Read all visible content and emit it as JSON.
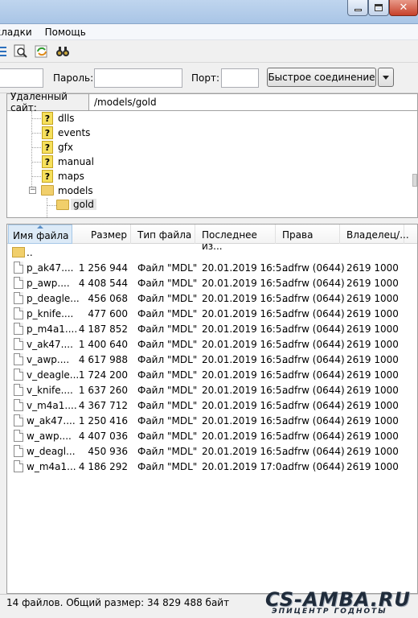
{
  "menubar": {
    "bookmarks": "кладки",
    "help": "Помощь"
  },
  "toolbar": {
    "icons": [
      "filter-icon",
      "search-files-icon",
      "sync-icon",
      "compare-icon"
    ]
  },
  "quickconnect": {
    "password_label": "Пароль:",
    "port_label": "Порт:",
    "button_label": "Быстрое соединение"
  },
  "remote_site": {
    "label": "Удаленный сайт:",
    "path": "/models/gold"
  },
  "tree": {
    "items": [
      {
        "label": "dlls"
      },
      {
        "label": "events"
      },
      {
        "label": "gfx"
      },
      {
        "label": "manual"
      },
      {
        "label": "maps"
      },
      {
        "label": "models"
      },
      {
        "label": "gold"
      }
    ]
  },
  "filelist": {
    "headers": [
      "Имя файла",
      "Размер",
      "Тип файла",
      "Последнее из...",
      "Права",
      "Владелец/..."
    ],
    "parent": "..",
    "rows": [
      {
        "name": "p_ak47....",
        "size": "1 256 944",
        "type": "Файл \"MDL\"",
        "modified": "20.01.2019 16:5...",
        "perms": "adfrw (0644)",
        "owner": "2619 1000"
      },
      {
        "name": "p_awp....",
        "size": "4 408 544",
        "type": "Файл \"MDL\"",
        "modified": "20.01.2019 16:5...",
        "perms": "adfrw (0644)",
        "owner": "2619 1000"
      },
      {
        "name": "p_deagle...",
        "size": "456 068",
        "type": "Файл \"MDL\"",
        "modified": "20.01.2019 16:5...",
        "perms": "adfrw (0644)",
        "owner": "2619 1000"
      },
      {
        "name": "p_knife....",
        "size": "477 600",
        "type": "Файл \"MDL\"",
        "modified": "20.01.2019 16:5...",
        "perms": "adfrw (0644)",
        "owner": "2619 1000"
      },
      {
        "name": "p_m4a1....",
        "size": "4 187 852",
        "type": "Файл \"MDL\"",
        "modified": "20.01.2019 16:5...",
        "perms": "adfrw (0644)",
        "owner": "2619 1000"
      },
      {
        "name": "v_ak47....",
        "size": "1 400 640",
        "type": "Файл \"MDL\"",
        "modified": "20.01.2019 16:5...",
        "perms": "adfrw (0644)",
        "owner": "2619 1000"
      },
      {
        "name": "v_awp....",
        "size": "4 617 988",
        "type": "Файл \"MDL\"",
        "modified": "20.01.2019 16:5...",
        "perms": "adfrw (0644)",
        "owner": "2619 1000"
      },
      {
        "name": "v_deagle...",
        "size": "1 724 200",
        "type": "Файл \"MDL\"",
        "modified": "20.01.2019 16:5...",
        "perms": "adfrw (0644)",
        "owner": "2619 1000"
      },
      {
        "name": "v_knife....",
        "size": "1 637 260",
        "type": "Файл \"MDL\"",
        "modified": "20.01.2019 16:5...",
        "perms": "adfrw (0644)",
        "owner": "2619 1000"
      },
      {
        "name": "v_m4a1....",
        "size": "4 367 712",
        "type": "Файл \"MDL\"",
        "modified": "20.01.2019 16:5...",
        "perms": "adfrw (0644)",
        "owner": "2619 1000"
      },
      {
        "name": "w_ak47....",
        "size": "1 250 416",
        "type": "Файл \"MDL\"",
        "modified": "20.01.2019 16:5...",
        "perms": "adfrw (0644)",
        "owner": "2619 1000"
      },
      {
        "name": "w_awp....",
        "size": "4 407 036",
        "type": "Файл \"MDL\"",
        "modified": "20.01.2019 16:5...",
        "perms": "adfrw (0644)",
        "owner": "2619 1000"
      },
      {
        "name": "w_deagl...",
        "size": "450 936",
        "type": "Файл \"MDL\"",
        "modified": "20.01.2019 16:5...",
        "perms": "adfrw (0644)",
        "owner": "2619 1000"
      },
      {
        "name": "w_m4a1...",
        "size": "4 186 292",
        "type": "Файл \"MDL\"",
        "modified": "20.01.2019 17:0...",
        "perms": "adfrw (0644)",
        "owner": "2619 1000"
      }
    ]
  },
  "status": {
    "text": "14 файлов. Общий размер: 34 829 488 байт"
  },
  "watermark": {
    "logo": "CS-AMBA.RU",
    "tagline": "ЭПИЦЕНТР ГОДНОТЫ"
  }
}
